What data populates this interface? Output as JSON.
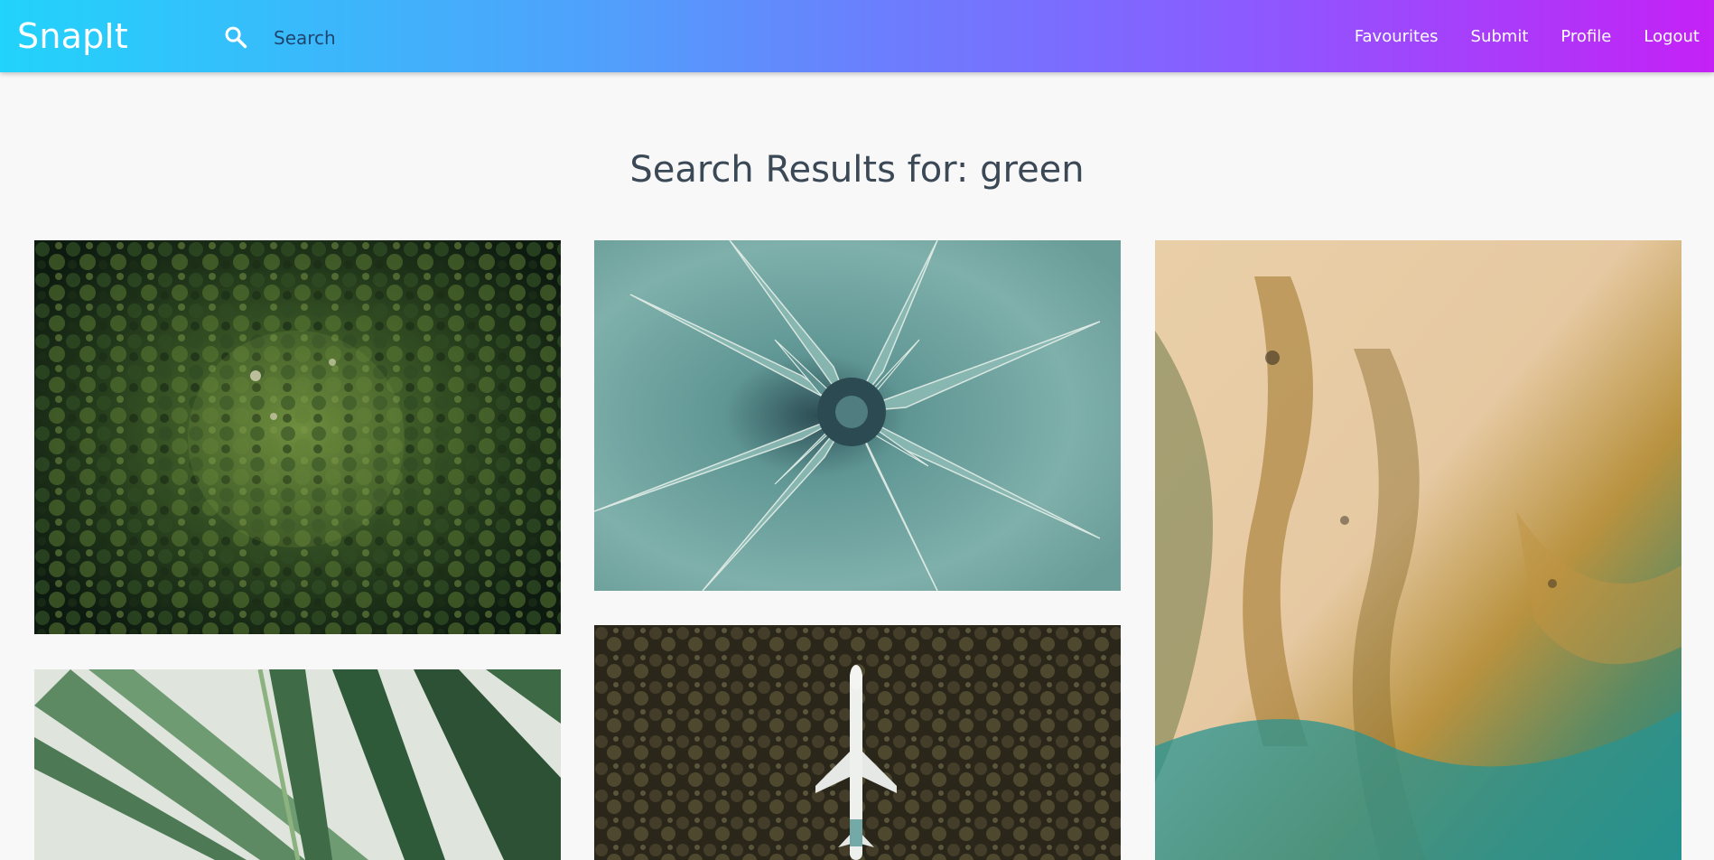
{
  "app": {
    "brand": "SnapIt"
  },
  "search": {
    "placeholder": "Search",
    "value": ""
  },
  "nav": {
    "items": [
      {
        "label": "Favourites"
      },
      {
        "label": "Submit"
      },
      {
        "label": "Profile"
      },
      {
        "label": "Logout"
      }
    ]
  },
  "results": {
    "heading": "Search Results for: green"
  },
  "colors": {
    "gradient_start": "#22d3fb",
    "gradient_end": "#c421f6",
    "page_background": "#f8f8f8",
    "heading_text": "#3b4856"
  },
  "icons": {
    "search": "magnifier-icon"
  }
}
